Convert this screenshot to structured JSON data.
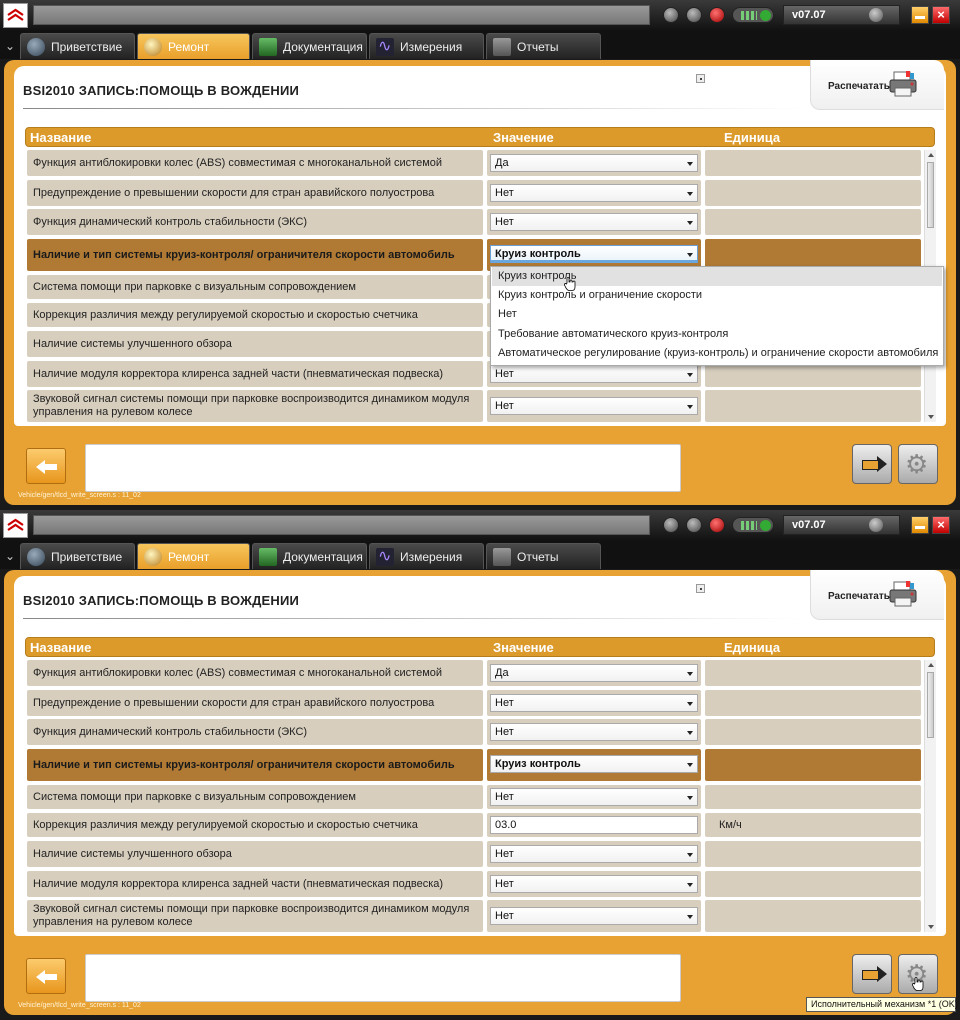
{
  "app": {
    "version": "v07.07"
  },
  "tabs": [
    {
      "label": "Приветствие"
    },
    {
      "label": "Ремонт"
    },
    {
      "label": "Документация"
    },
    {
      "label": "Измерения"
    },
    {
      "label": "Отчеты"
    }
  ],
  "page": {
    "title": "BSI2010  ЗАПИСЬ:ПОМОЩЬ В ВОЖДЕНИИ",
    "print_label": "Распечатать",
    "path": "Vehicle/gen/tlcd_write_screen.s : 11_02"
  },
  "table": {
    "headers": {
      "name": "Название",
      "value": "Значение",
      "unit": "Единица"
    }
  },
  "screen1": {
    "rows": [
      {
        "name": "Функция антиблокировки колес (ABS) совместимая с многоканальной системой",
        "value": "Да",
        "unit": ""
      },
      {
        "name": "Предупреждение о превышении скорости для стран аравийского полуострова",
        "value": "Нет",
        "unit": ""
      },
      {
        "name": "Функция динамический контроль стабильности (ЭКС)",
        "value": "Нет",
        "unit": ""
      },
      {
        "name": "Наличие и тип системы круиз-контроля/ ограничителя скорости автомобиль",
        "value": "Круиз контроль",
        "unit": ""
      },
      {
        "name": "Система помощи при парковке с визуальным сопровождением",
        "value": "",
        "unit": ""
      },
      {
        "name": "Коррекция различия между регулируемой скоростью и скоростью счетчика",
        "value": "",
        "unit": ""
      },
      {
        "name": "Наличие системы улучшенного обзора",
        "value": "",
        "unit": ""
      },
      {
        "name": "Наличие модуля корректора клиренса задней части (пневматическая подвеска)",
        "value": "Нет",
        "unit": ""
      },
      {
        "name": "Звуковой сигнал системы помощи при парковке воспроизводится динамиком модуля управления на рулевом колесе",
        "value": "Нет",
        "unit": ""
      }
    ],
    "dropdown_options": [
      "Круиз контроль",
      "Круиз контроль и ограничение скорости",
      "Нет",
      "Требование автоматического круиз-контроля",
      "Автоматическое регулирование (круиз-контроль) и ограничение скорости автомобиля"
    ]
  },
  "screen2": {
    "rows": [
      {
        "name": "Функция антиблокировки колес (ABS) совместимая с многоканальной системой",
        "value": "Да",
        "unit": ""
      },
      {
        "name": "Предупреждение о превышении скорости для стран аравийского полуострова",
        "value": "Нет",
        "unit": ""
      },
      {
        "name": "Функция динамический контроль стабильности (ЭКС)",
        "value": "Нет",
        "unit": ""
      },
      {
        "name": "Наличие и тип системы круиз-контроля/ ограничителя скорости автомобиль",
        "value": "Круиз контроль",
        "unit": ""
      },
      {
        "name": "Система помощи при парковке с визуальным сопровождением",
        "value": "Нет",
        "unit": ""
      },
      {
        "name": "Коррекция различия между регулируемой скоростью и скоростью счетчика",
        "value": "03.0",
        "unit": "Км/ч"
      },
      {
        "name": "Наличие системы улучшенного обзора",
        "value": "Нет",
        "unit": ""
      },
      {
        "name": "Наличие модуля корректора клиренса задней части (пневматическая подвеска)",
        "value": "Нет",
        "unit": ""
      },
      {
        "name": "Звуковой сигнал системы помощи при парковке воспроизводится динамиком модуля управления на рулевом колесе",
        "value": "Нет",
        "unit": ""
      }
    ],
    "tooltip": "Исполнительный механизм *1 (OK)"
  },
  "colors": {
    "accent": "#e8a233",
    "header": "#dc9a2a",
    "row": "#d7cebe",
    "row_selected": "#b07a35"
  },
  "icons": {
    "logo": "brand-logo-icon",
    "print": "printer-icon",
    "back": "arrow-left-icon",
    "next": "arrow-right-icon",
    "actuator": "gear-icon"
  }
}
